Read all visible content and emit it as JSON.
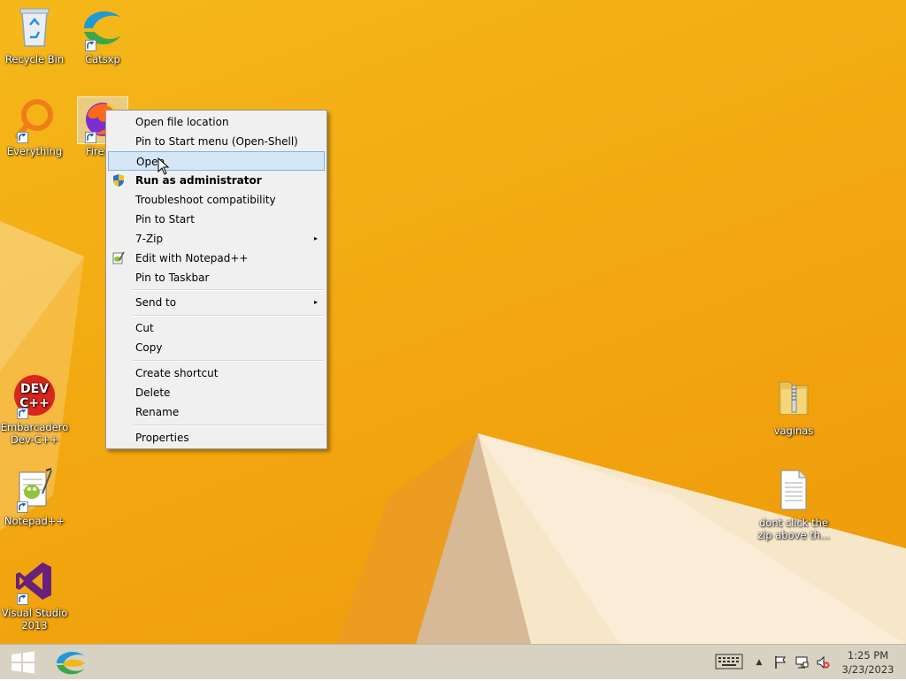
{
  "desktop": {
    "icons": [
      {
        "label": "Recycle Bin"
      },
      {
        "label": "Catsxp"
      },
      {
        "label": "Everything"
      },
      {
        "label": "Fire"
      },
      {
        "label": "Embarcadero Dev-C++"
      },
      {
        "label": "Notepad++"
      },
      {
        "label": "Visual Studio 2013"
      },
      {
        "label": "vaginas"
      },
      {
        "label": "dont click the zip above th..."
      }
    ],
    "devcpp_badge": {
      "line1": "DEV",
      "line2": "C++"
    }
  },
  "context_menu": {
    "items": [
      {
        "label": "Open file location"
      },
      {
        "label": "Pin to Start menu (Open-Shell)"
      },
      {
        "label": "Open"
      },
      {
        "label": "Run as administrator"
      },
      {
        "label": "Troubleshoot compatibility"
      },
      {
        "label": "Pin to Start"
      },
      {
        "label": "7-Zip"
      },
      {
        "label": "Edit with Notepad++"
      },
      {
        "label": "Pin to Taskbar"
      },
      {
        "label": "Send to"
      },
      {
        "label": "Cut"
      },
      {
        "label": "Copy"
      },
      {
        "label": "Create shortcut"
      },
      {
        "label": "Delete"
      },
      {
        "label": "Rename"
      },
      {
        "label": "Properties"
      }
    ],
    "submenu_arrow": "▸"
  },
  "taskbar": {
    "clock": {
      "time": "1:25 PM",
      "date": "3/23/2023"
    },
    "tray_chevron": "▲"
  },
  "colors": {
    "desktop_background": "#f2a60f",
    "menu_background": "#f0f0f0",
    "menu_hover": "#d5e7f7",
    "taskbar": "#d8d2c2"
  }
}
